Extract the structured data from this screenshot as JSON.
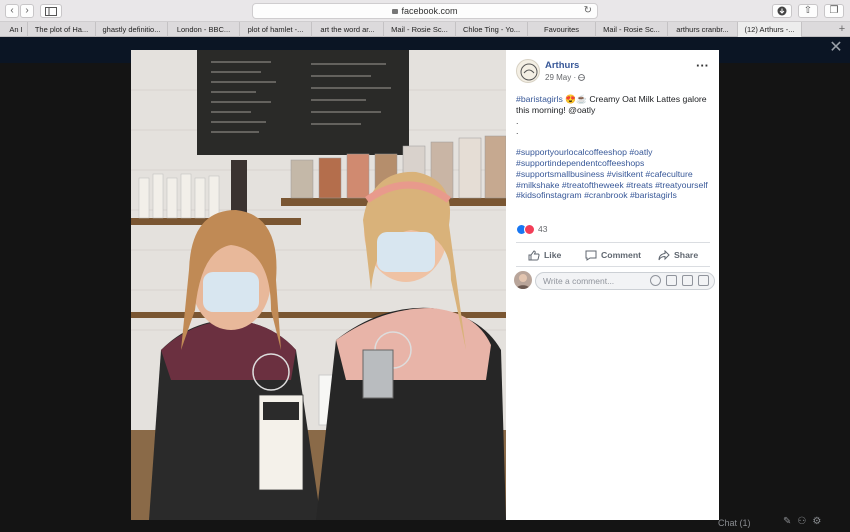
{
  "browser": {
    "address": "facebook.com",
    "tabs": [
      {
        "label": "An I",
        "active": false
      },
      {
        "label": "The plot of Ha...",
        "active": false
      },
      {
        "label": "ghastly definitio...",
        "active": false
      },
      {
        "label": "London - BBC...",
        "active": false
      },
      {
        "label": "plot of hamlet -...",
        "active": false
      },
      {
        "label": "art the word ar...",
        "active": false
      },
      {
        "label": "Mail - Rosie Sc...",
        "active": false
      },
      {
        "label": "Chloe Ting - Yo...",
        "active": false
      },
      {
        "label": "Favourites",
        "active": false
      },
      {
        "label": "Mail - Rosie Sc...",
        "active": false
      },
      {
        "label": "arthurs cranbr...",
        "active": false
      },
      {
        "label": "(12) Arthurs -...",
        "active": true
      }
    ],
    "icons": [
      "back-icon",
      "forward-icon",
      "sidebar-icon",
      "lock-icon",
      "reload-icon",
      "download-icon",
      "share-icon",
      "tabs-overview-icon",
      "new-tab-icon"
    ]
  },
  "post": {
    "page_name": "Arthurs",
    "date": "29 May",
    "audience_icon": "globe-icon",
    "text_line1_tag": "#baristagirls",
    "text_line1_emoji": "😍☕",
    "text_line1_rest": " Creamy Oat Milk Lattes galore this morning! @oatly",
    "dot1": ".",
    "dot2": ".",
    "hashtags": "#supportyourlocalcoffeeshop #oatly #supportindependentcoffeeshops #supportsmallbusiness #visitkent #cafeculture #milkshake #treatoftheweek #treats #treatyourself #kidsofinstagram #cranbrook #baristagirls",
    "reaction_count": "43",
    "actions": {
      "like": "Like",
      "comment": "Comment",
      "share": "Share"
    },
    "comment_placeholder": "Write a comment..."
  },
  "chat": {
    "label": "Chat (1)"
  },
  "colors": {
    "fb_link": "#385898",
    "like_blue": "#1877f2",
    "love_red": "#f33e58"
  }
}
